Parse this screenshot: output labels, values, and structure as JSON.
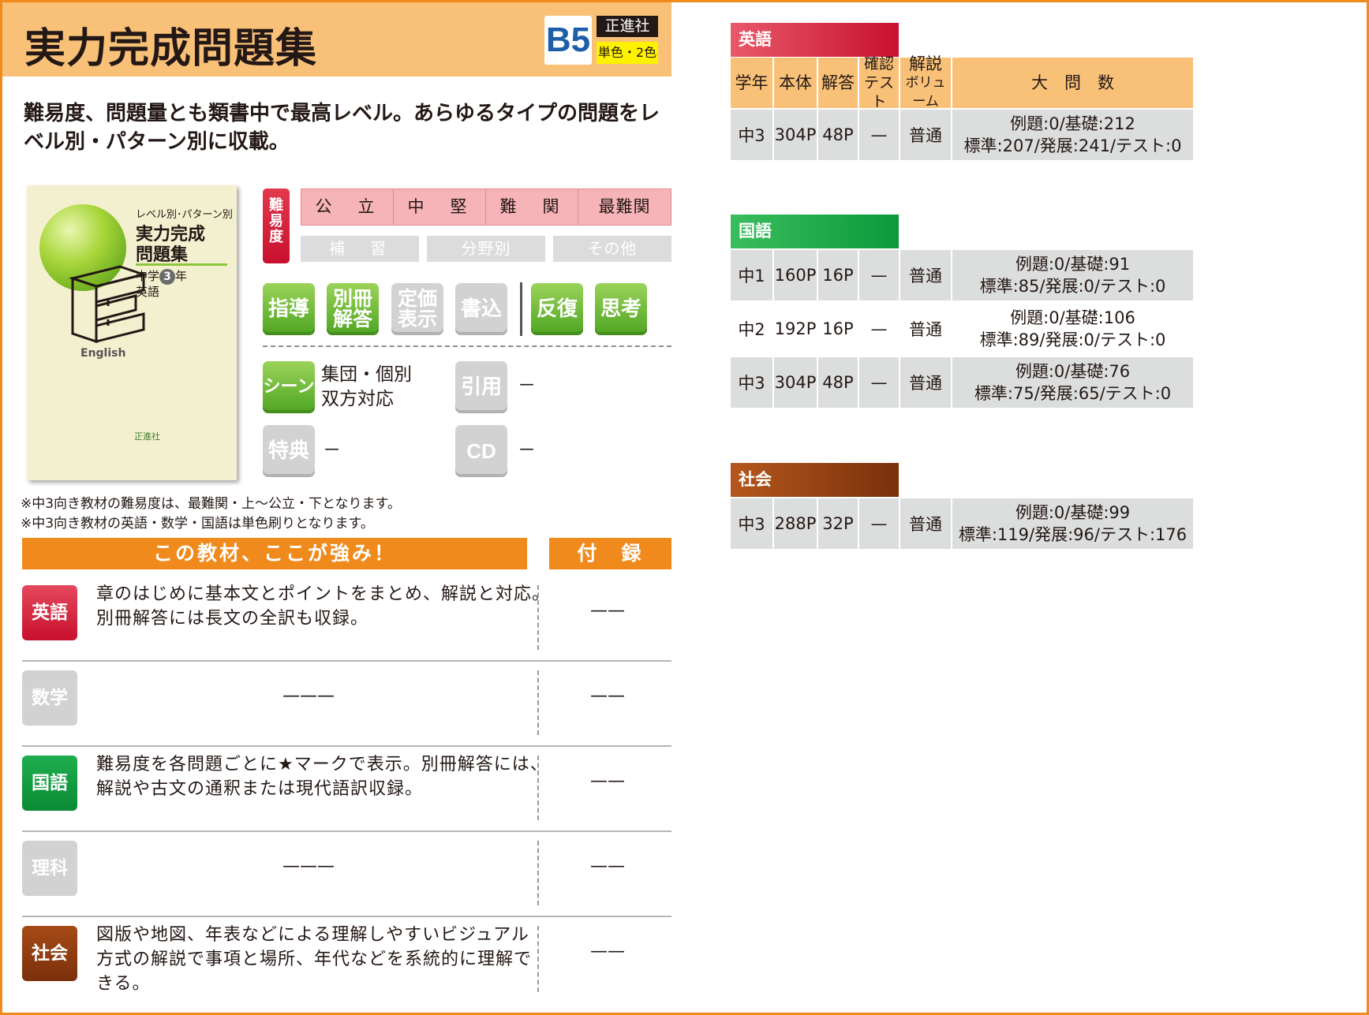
{
  "header": {
    "title": "実力完成問題集",
    "size_badge": "B5",
    "publisher": "正進社",
    "colors": "単色・2色"
  },
  "description": "難易度、問題量とも類書中で最高レベル。あらゆるタイプの問題をレベル別・パターン別に収載。",
  "cover": {
    "subtitle": "レベル別･パターン別",
    "title_line1": "実力完成",
    "title_line2": "問題集",
    "grade_prefix": "中学",
    "grade_num": "3",
    "grade_suffix": "年",
    "subject": "英語",
    "english": "English",
    "logo": "正進社"
  },
  "notes": [
    "※中3向き教材の難易度は、最難関・上～公立・下となります。",
    "※中3向き教材の英語・数学・国語は単色刷りとなります。"
  ],
  "difficulty": {
    "tag": "難易度",
    "levels": [
      "公　立",
      "中　堅",
      "難　関",
      "最難関"
    ],
    "sub_levels": [
      "補　習",
      "分野別",
      "その他"
    ]
  },
  "features": [
    {
      "line1": "指導",
      "line2": "",
      "active": true
    },
    {
      "line1": "別冊",
      "line2": "解答",
      "active": true
    },
    {
      "line1": "定価",
      "line2": "表示",
      "active": false
    },
    {
      "line1": "書込",
      "line2": "",
      "active": false
    },
    {
      "line1": "反復",
      "line2": "",
      "active": true
    },
    {
      "line1": "思考",
      "line2": "",
      "active": true
    }
  ],
  "info": {
    "scene_label": "シーン",
    "scene_line1": "集団・個別",
    "scene_line2": "双方対応",
    "quote_label": "引用",
    "quote_value": "－",
    "bonus_label": "特典",
    "bonus_value": "－",
    "cd_label": "CD",
    "cd_value": "－"
  },
  "strengths": {
    "header": "この教材、ここが強み！",
    "supplement_header": "付　録",
    "rows": [
      {
        "subject": "英語",
        "color": "#d7283e",
        "active": true,
        "line1": "章のはじめに基本文とポイントをまとめ、解説と対応。",
        "line2": "別冊解答には長文の全訳も収録。",
        "line3": "",
        "supplement": "——"
      },
      {
        "subject": "数学",
        "color": "#d2d2d2",
        "active": false,
        "line1": "",
        "line2": "",
        "line3": "",
        "placeholder": "———",
        "supplement": "——"
      },
      {
        "subject": "国語",
        "color": "#0a9a3c",
        "active": true,
        "line1": "難易度を各問題ごとに★マークで表示。別冊解答には、",
        "line2": "解説や古文の通釈または現代語訳収録。",
        "line3": "",
        "supplement": "——"
      },
      {
        "subject": "理科",
        "color": "#d2d2d2",
        "active": false,
        "line1": "",
        "line2": "",
        "line3": "",
        "placeholder": "———",
        "supplement": "——"
      },
      {
        "subject": "社会",
        "color": "#8b3a0f",
        "active": true,
        "line1": "図版や地図、年表などによる理解しやすいビジュアル",
        "line2": "方式の解説で事項と場所、年代などを系統的に理解で",
        "line3": "きる。",
        "supplement": "——"
      }
    ]
  },
  "tables": {
    "headers": {
      "grade": "学年",
      "pages": "本体",
      "answer": "解答",
      "check1": "確認",
      "check2": "テスト",
      "vol1": "解説",
      "vol2": "ボリューム",
      "questions": "大　問　数"
    },
    "english": {
      "name": "英語",
      "color": "#d7283e",
      "rows": [
        {
          "grade": "中3",
          "pages": "304P",
          "answer": "48P",
          "check": "—",
          "volume": "普通",
          "q1": "例題:0/基礎:212",
          "q2": "標準:207/発展:241/テスト:0"
        }
      ]
    },
    "japanese": {
      "name": "国語",
      "color": "#0a9a3c",
      "rows": [
        {
          "grade": "中1",
          "pages": "160P",
          "answer": "16P",
          "check": "—",
          "volume": "普通",
          "q1": "例題:0/基礎:91",
          "q2": "標準:85/発展:0/テスト:0"
        },
        {
          "grade": "中2",
          "pages": "192P",
          "answer": "16P",
          "check": "—",
          "volume": "普通",
          "q1": "例題:0/基礎:106",
          "q2": "標準:89/発展:0/テスト:0"
        },
        {
          "grade": "中3",
          "pages": "304P",
          "answer": "48P",
          "check": "—",
          "volume": "普通",
          "q1": "例題:0/基礎:76",
          "q2": "標準:75/発展:65/テスト:0"
        }
      ]
    },
    "social": {
      "name": "社会",
      "color": "#8b3a0f",
      "rows": [
        {
          "grade": "中3",
          "pages": "288P",
          "answer": "32P",
          "check": "—",
          "volume": "普通",
          "q1": "例題:0/基礎:99",
          "q2": "標準:119/発展:96/テスト:176"
        }
      ]
    }
  }
}
